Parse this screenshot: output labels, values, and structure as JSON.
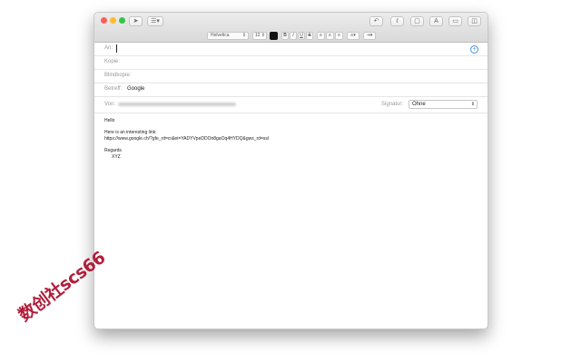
{
  "toolbar": {
    "font_family": "Helvetica",
    "font_size": "12",
    "bold": "B",
    "italic": "I",
    "underline": "U",
    "strike": "S",
    "font_panel_label": "A"
  },
  "fields": {
    "to": {
      "label": "An:",
      "value": ""
    },
    "cc": {
      "label": "Kopie:",
      "value": ""
    },
    "bcc": {
      "label": "Blindkopie:",
      "value": ""
    },
    "subject": {
      "label": "Betreff:",
      "value": "Google"
    },
    "from": {
      "label": "Von:"
    },
    "signature": {
      "label": "Signatur:",
      "value": "Ohne"
    }
  },
  "body": {
    "greeting": "Hello",
    "line1": "Here is an interesting link:",
    "link": "https://www.google.ch/?gfe_rd=cr&ei=YADYVpeDDOn8gaOq4HYDQ&gws_rd=ssl",
    "closing": "Regards",
    "name": "XYZ"
  },
  "watermark": "数创社scs66",
  "colors": {
    "close": "#fc5f57",
    "minimize": "#fdbc2e",
    "zoom": "#33c748",
    "accent": "#4a90d9",
    "watermark": "#b01e3c"
  }
}
